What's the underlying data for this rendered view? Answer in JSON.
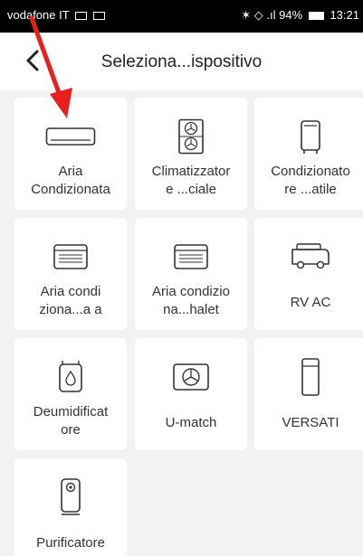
{
  "status_bar": {
    "carrier": "vodafone IT",
    "signal_text": ".ıl",
    "battery_percent": "94%",
    "time": "13:21"
  },
  "header": {
    "title": "Seleziona...ispositivo",
    "back_icon": "chevron-left-icon"
  },
  "devices": [
    {
      "label_line1": "Aria",
      "label_line2": "Condizionata",
      "icon": "split-ac-icon"
    },
    {
      "label_line1": "Climatizzator",
      "label_line2": "e ...ciale",
      "icon": "commercial-ac-icon"
    },
    {
      "label_line1": "Condizionato",
      "label_line2": "re ...atile",
      "icon": "portable-ac-icon"
    },
    {
      "label_line1": "Aria condi",
      "label_line2": "ziona...a a",
      "icon": "window-ac-icon"
    },
    {
      "label_line1": "Aria condizio",
      "label_line2": "na...halet",
      "icon": "window-ac-icon"
    },
    {
      "label_line1": "RV AC",
      "label_line2": "",
      "icon": "rv-icon"
    },
    {
      "label_line1": "Deumidificat",
      "label_line2": "ore",
      "icon": "dehumidifier-icon"
    },
    {
      "label_line1": "U-match",
      "label_line2": "",
      "icon": "u-match-icon"
    },
    {
      "label_line1": "VERSATI",
      "label_line2": "",
      "icon": "tower-unit-icon"
    },
    {
      "label_line1": "Purificatore",
      "label_line2": "",
      "icon": "purifier-icon"
    }
  ],
  "colors": {
    "background": "#f2f2f2",
    "card": "#ffffff",
    "annotation_arrow": "#e8201c"
  }
}
